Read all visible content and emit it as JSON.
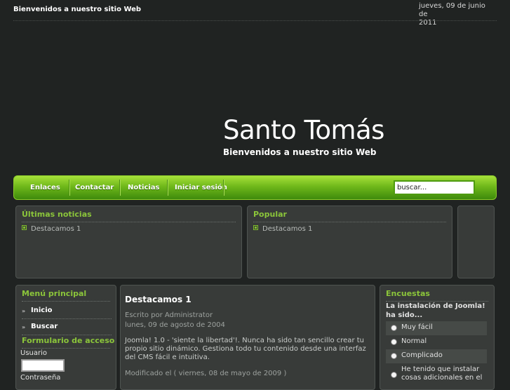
{
  "topbar": {
    "welcome": "Bienvenidos a nuestro sitio Web",
    "date_line1": "jueves, 09 de junio de",
    "date_line2": "2011"
  },
  "header": {
    "site_name": "Santo Tomás",
    "slogan": "Bienvenidos a nuestro sitio Web"
  },
  "nav": {
    "items": [
      {
        "label": "Enlaces"
      },
      {
        "label": "Contactar"
      },
      {
        "label": "Noticias"
      },
      {
        "label": "Iniciar sesión"
      }
    ],
    "search_value": "buscar..."
  },
  "latest_news": {
    "title": "Últimas noticias",
    "items": [
      "Destacamos 1"
    ]
  },
  "popular": {
    "title": "Popular",
    "items": [
      "Destacamos 1"
    ]
  },
  "main_menu": {
    "title": "Menú principal",
    "items": [
      {
        "label": "Inicio"
      },
      {
        "label": "Buscar"
      }
    ]
  },
  "login": {
    "title": "Formulario de acceso",
    "user_label": "Usuario",
    "password_label": "Contraseña"
  },
  "article": {
    "title": "Destacamos 1",
    "author": "Escrito por Administrator",
    "date": "lunes, 09 de agosto de 2004",
    "body": "Joomla! 1.0 - 'siente la libertad'!. Nunca ha sido tan sencillo crear tu propio sitio dinámico. Gestiona todo tu contenido desde una interfaz del CMS fácil e intuitiva.",
    "modified": "Modificado el ( viernes, 08 de mayo de 2009 )"
  },
  "poll": {
    "title": "Encuestas",
    "question": "La instalación de Joomla! ha sido...",
    "options": [
      {
        "label": "Muy fácil"
      },
      {
        "label": "Normal"
      },
      {
        "label": "Complicado"
      },
      {
        "label": "He tenido que instalar cosas adicionales en el"
      }
    ]
  }
}
